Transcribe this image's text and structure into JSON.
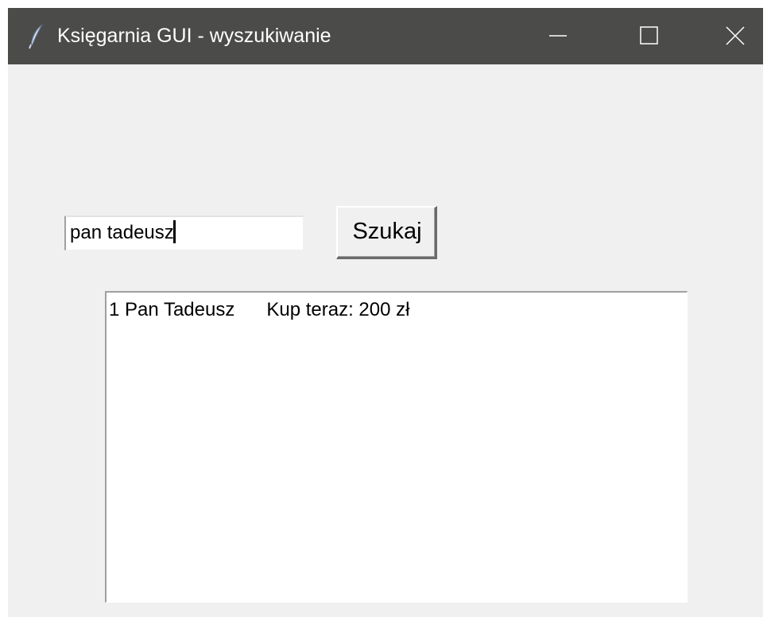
{
  "window": {
    "title": "Księgarnia GUI - wyszukiwanie",
    "icon": "feather-icon",
    "titlebar_color": "#4b4b49",
    "background_color": "#f0f0f0",
    "controls": [
      "minimize-icon",
      "maximize-icon",
      "close-icon"
    ]
  },
  "search": {
    "value": "pan tadeusz",
    "button_label": "Szukaj"
  },
  "results": {
    "items": [
      {
        "text": "1 Pan Tadeusz      Kup teraz: 200 zł"
      }
    ]
  }
}
